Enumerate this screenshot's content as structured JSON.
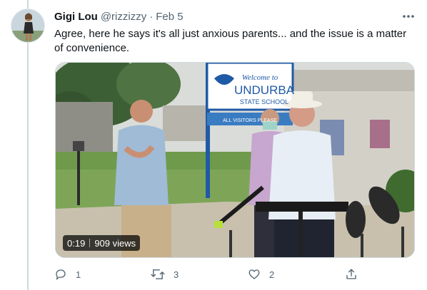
{
  "tweet": {
    "author_name": "Gigi Lou",
    "author_handle": "@rizzizzy",
    "separator": "·",
    "date": "Feb 5",
    "text": "Agree, here he says it's all just anxious parents... and the issue is a matter of convenience."
  },
  "video": {
    "duration": "0:19",
    "views": "909 views",
    "sign_line1": "Welcome to",
    "sign_line2": "UNDURBA",
    "sign_line3": "STATE SCHOOL",
    "sign_sub": "ALL VISITORS PLEASE"
  },
  "actions": {
    "reply_count": "1",
    "retweet_count": "3",
    "like_count": "2"
  },
  "icons": [
    "more-icon",
    "reply-icon",
    "retweet-icon",
    "like-icon",
    "share-icon"
  ],
  "colors": {
    "text_primary": "#0f1419",
    "text_secondary": "#536471",
    "border": "#cfd9de",
    "sign_blue": "#1f5aa6"
  }
}
